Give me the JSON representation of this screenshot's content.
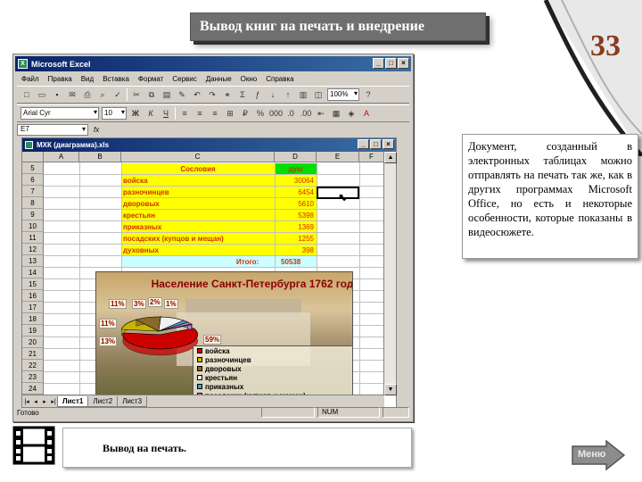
{
  "slide": {
    "title": "Вывод  книг на печать и внедрение",
    "page_number": "33",
    "description": "Документ, созданный в электронных таблицах можно отправлять на печать так же, как в других программах Microsoft Office, но есть и некоторые особенности, которые показаны в видеосюжете.",
    "caption": "Вывод на печать.",
    "menu_button": "Меню"
  },
  "excel": {
    "window_title": "Microsoft Excel",
    "menu": [
      "Файл",
      "Правка",
      "Вид",
      "Вставка",
      "Формат",
      "Сервис",
      "Данные",
      "Окно",
      "Справка"
    ],
    "zoom": "100%",
    "font_name": "Arial Cyr",
    "font_size": "10",
    "name_box": "E7",
    "fx": "fx",
    "workbook_title": "МХК (диаграмма).xls",
    "columns": [
      "A",
      "B",
      "C",
      "D",
      "E",
      "F"
    ],
    "rows": [
      "5",
      "6",
      "7",
      "8",
      "9",
      "10",
      "11",
      "12",
      "13",
      "14",
      "15",
      "16",
      "17",
      "18",
      "19",
      "20",
      "21",
      "22",
      "23",
      "24"
    ],
    "table": {
      "header_label": "Сословия",
      "header_value": "душ",
      "items": [
        {
          "label": "войска",
          "value": "30064"
        },
        {
          "label": "разночинцев",
          "value": "6454"
        },
        {
          "label": "дворовых",
          "value": "5610"
        },
        {
          "label": "крестьян",
          "value": "5398"
        },
        {
          "label": "приказных",
          "value": "1369"
        },
        {
          "label": "посадских (купцов и мещан)",
          "value": "1255"
        },
        {
          "label": "духовных",
          "value": "398"
        }
      ],
      "total_label": "Итого:",
      "total_value": "50538"
    },
    "sheet_tabs": [
      "Лист1",
      "Лист2",
      "Лист3"
    ],
    "status_left": "Готово",
    "status_num": "NUM"
  },
  "chart_data": {
    "type": "pie",
    "title": "Население Санкт-Петербурга 1762 год",
    "categories": [
      "войска",
      "разночинцев",
      "дворовых",
      "крестьян",
      "приказных",
      "посадских (купцов и мещан)",
      "духовных"
    ],
    "values": [
      30064,
      6454,
      5610,
      5398,
      1369,
      1255,
      398
    ],
    "labels": [
      "59%",
      "13%",
      "11%",
      "11%",
      "3%",
      "2%",
      "1%"
    ],
    "colors": [
      "#cc0000",
      "#c8b400",
      "#8a6a2a",
      "#f0f0f0",
      "#4aa0c8",
      "#d070d0",
      "#aaaaaa"
    ],
    "legend_position": "bottom-right"
  }
}
